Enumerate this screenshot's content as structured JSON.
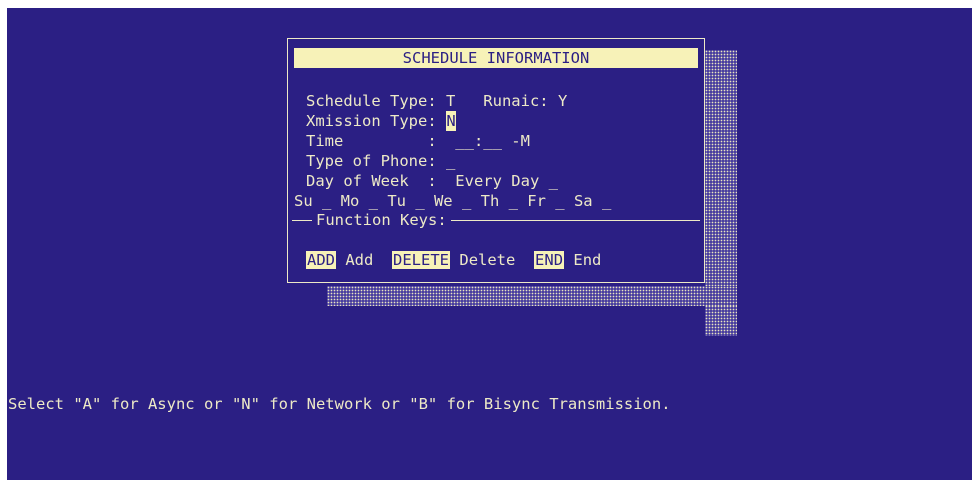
{
  "dialog": {
    "title": "SCHEDULE INFORMATION",
    "lines": {
      "schedule_type": "Schedule Type: T   Runaic: Y",
      "xmission_label": "Xmission Type: ",
      "xmission_value": "N",
      "time": "Time         :  __:__ -M",
      "phone": "Type of Phone: _",
      "day_of_week": "Day of Week  :  Every Day _",
      "days": "Su _ Mo _ Tu _ We _ Th _ Fr _ Sa _"
    },
    "function_keys_label": "Function Keys:",
    "keys": [
      {
        "key": "ADD",
        "label": "Add"
      },
      {
        "key": "DELETE",
        "label": "Delete"
      },
      {
        "key": "END",
        "label": "End"
      }
    ]
  },
  "status_line": "Select \"A\" for Async or \"N\" for Network or \"B\" for Bisync Transmission.",
  "colors": {
    "background": "#2b1f84",
    "text": "#ede9c7",
    "highlight": "#f7f2b8"
  }
}
